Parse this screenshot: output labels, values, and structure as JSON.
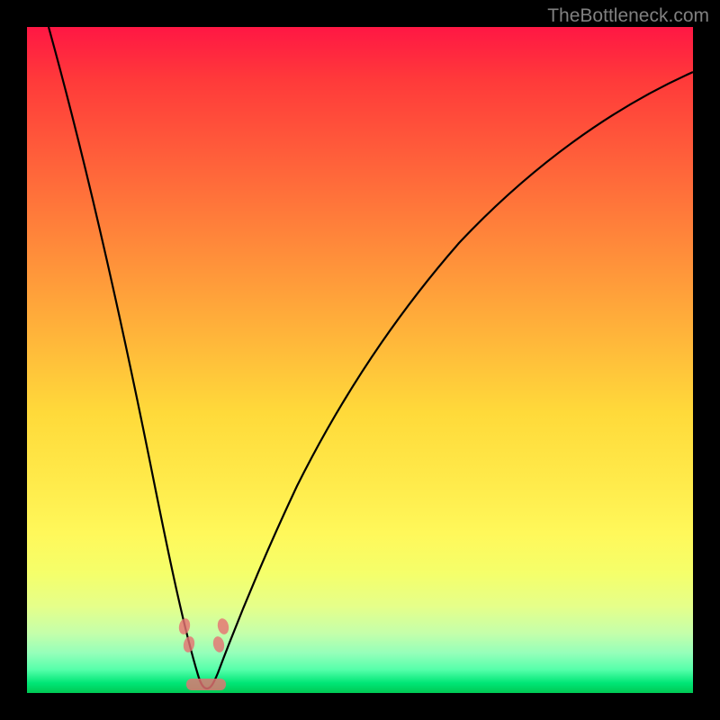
{
  "watermark": "TheBottleneck.com",
  "chart_data": {
    "type": "line",
    "title": "",
    "xlabel": "",
    "ylabel": "",
    "xlim": [
      0,
      100
    ],
    "ylim": [
      0,
      100
    ],
    "background_gradient": {
      "top": "#ff1744",
      "middle": "#ffee58",
      "bottom": "#00c853"
    },
    "series": [
      {
        "name": "bottleneck-curve",
        "description": "V-shaped curve with minimum near x=26",
        "x": [
          3,
          6,
          9,
          12,
          15,
          18,
          21,
          24,
          26,
          28,
          30,
          35,
          40,
          45,
          50,
          55,
          60,
          65,
          70,
          75,
          80,
          85,
          90,
          95,
          100
        ],
        "values": [
          100,
          86,
          72,
          58,
          44,
          31,
          19,
          8,
          0,
          2,
          8,
          20,
          30,
          39,
          47,
          54,
          60,
          65,
          70,
          74,
          77,
          80,
          83,
          85,
          87
        ]
      }
    ],
    "markers": [
      {
        "name": "left-dot-upper",
        "x": 23.5,
        "y": 10
      },
      {
        "name": "left-dot-lower",
        "x": 24.2,
        "y": 7.2
      },
      {
        "name": "right-dot-upper",
        "x": 29.5,
        "y": 10
      },
      {
        "name": "right-dot-lower",
        "x": 28.8,
        "y": 7.2
      },
      {
        "name": "bottom-bar",
        "x": 26.5,
        "y": 1.5
      }
    ]
  }
}
